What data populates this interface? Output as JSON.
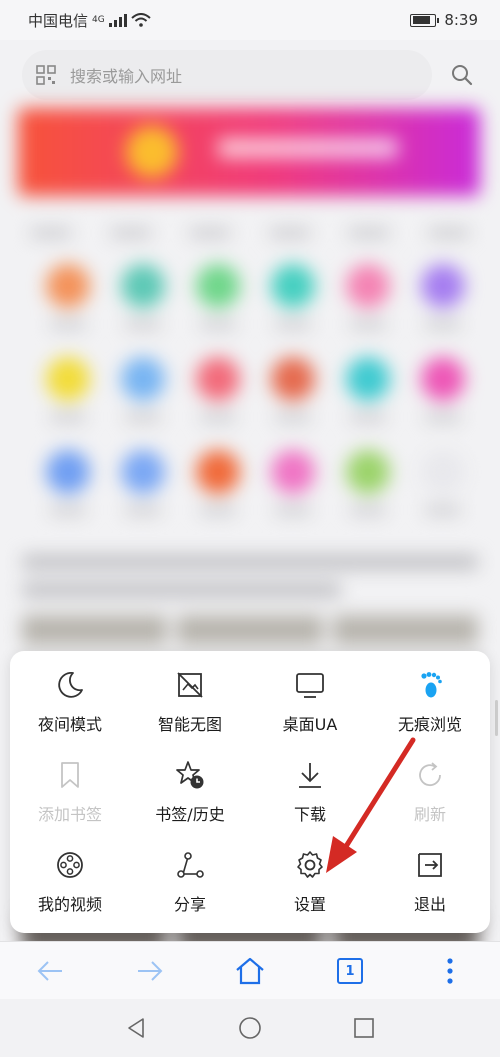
{
  "status_bar": {
    "carrier": "中国电信",
    "network": "4G",
    "time": "8:39"
  },
  "search": {
    "placeholder": "搜索或输入网址"
  },
  "menu": {
    "items": [
      {
        "label": "夜间模式",
        "icon": "moon-icon",
        "enabled": true
      },
      {
        "label": "智能无图",
        "icon": "no-image-icon",
        "enabled": true
      },
      {
        "label": "桌面UA",
        "icon": "monitor-icon",
        "enabled": true
      },
      {
        "label": "无痕浏览",
        "icon": "footprint-icon",
        "enabled": true
      },
      {
        "label": "添加书签",
        "icon": "bookmark-icon",
        "enabled": false
      },
      {
        "label": "书签/历史",
        "icon": "star-clock-icon",
        "enabled": true
      },
      {
        "label": "下载",
        "icon": "download-icon",
        "enabled": true
      },
      {
        "label": "刷新",
        "icon": "refresh-icon",
        "enabled": false
      },
      {
        "label": "我的视频",
        "icon": "film-reel-icon",
        "enabled": true
      },
      {
        "label": "分享",
        "icon": "share-icon",
        "enabled": true
      },
      {
        "label": "设置",
        "icon": "gear-icon",
        "enabled": true
      },
      {
        "label": "退出",
        "icon": "exit-icon",
        "enabled": true
      }
    ]
  },
  "bottom_nav": {
    "tab_count": "1"
  },
  "colors": {
    "accent": "#1e6fe8",
    "footprint": "#1aa3f2",
    "annotation_arrow": "#d42a24"
  }
}
